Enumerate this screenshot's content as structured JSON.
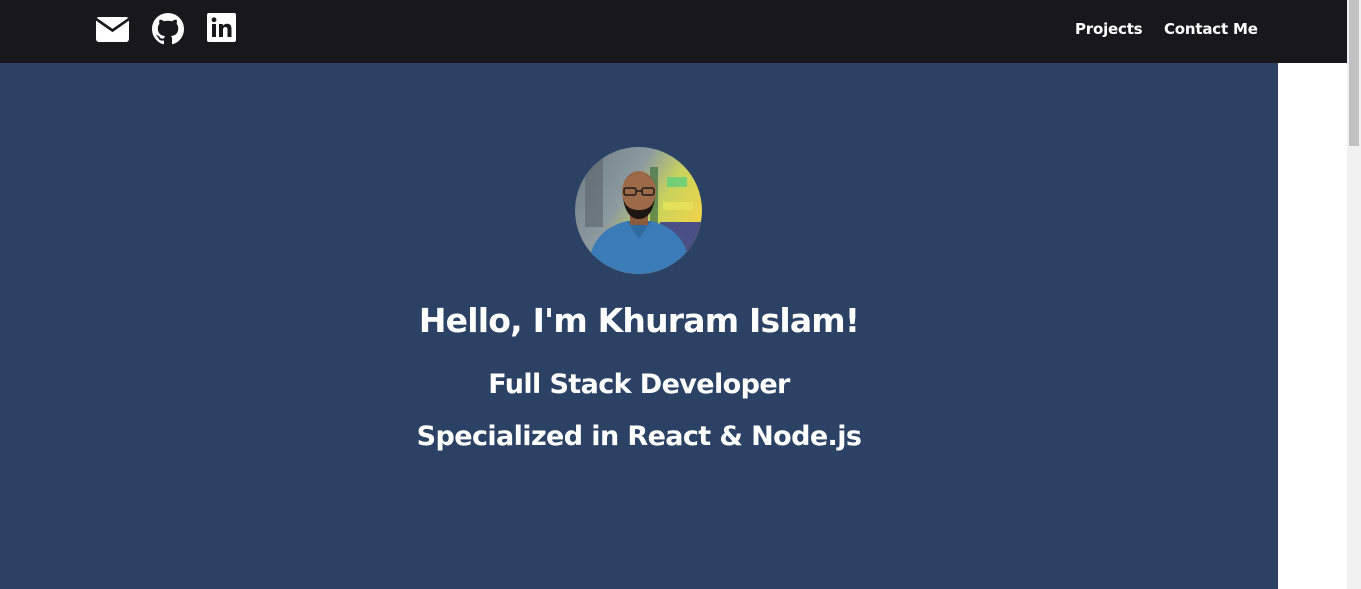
{
  "nav": {
    "icons": {
      "mail": "envelope-icon",
      "github": "github-icon",
      "linkedin": "linkedin-icon"
    },
    "links": {
      "projects": "Projects",
      "contact": "Contact Me"
    }
  },
  "hero": {
    "title": "Hello, I'm Khuram Islam!",
    "subtitle": "Full Stack Developer",
    "specialty": "Specialized in React & Node.js"
  },
  "colors": {
    "navbar": "#18181a",
    "hero": "#2c4264",
    "text": "#ffffff"
  }
}
